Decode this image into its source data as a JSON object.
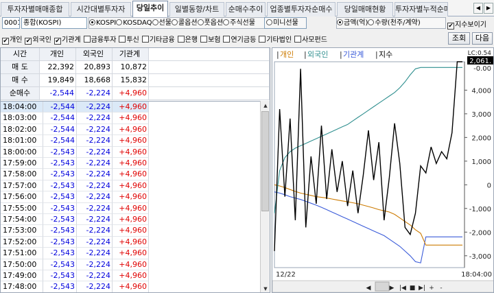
{
  "tabs": [
    "투자자별매매종합",
    "시간대별투자자",
    "당일추이",
    "일별동향/차트",
    "순매수추이",
    "업종별투자자순매수",
    "당일매매현황",
    "투자자별누적순매수"
  ],
  "active_tab": 2,
  "tab_nav": {
    "prev": "◀",
    "next": "▶"
  },
  "market": {
    "code": "0001",
    "name": "종합(KOSPI)"
  },
  "market_options": [
    {
      "label": "KOSPI",
      "selected": true
    },
    {
      "label": "KOSDAQ",
      "selected": false
    },
    {
      "label": "선물",
      "selected": false
    },
    {
      "label": "콜옵션",
      "selected": false
    },
    {
      "label": "풋옵션",
      "selected": false
    },
    {
      "label": "주식선물",
      "selected": false
    }
  ],
  "mini_futures": "미니선물",
  "unit_options": [
    {
      "label": "금액(억)",
      "selected": true
    },
    {
      "label": "수량(천주/계약)",
      "selected": false
    }
  ],
  "index_view": {
    "label": "지수보이기",
    "checked": true
  },
  "investor_filters": [
    {
      "label": "개인",
      "checked": true
    },
    {
      "label": "외국인",
      "checked": true
    },
    {
      "label": "기관계",
      "checked": true
    },
    {
      "label": "금융투자",
      "checked": false
    },
    {
      "label": "투신",
      "checked": false
    },
    {
      "label": "기타금융",
      "checked": false
    },
    {
      "label": "은행",
      "checked": false
    },
    {
      "label": "보험",
      "checked": false
    },
    {
      "label": "연기금등",
      "checked": false
    },
    {
      "label": "기타법인",
      "checked": false
    },
    {
      "label": "사모펀드",
      "checked": false
    }
  ],
  "buttons": {
    "query": "조회",
    "next": "다음"
  },
  "summary": {
    "headers": [
      "시간",
      "개인",
      "외국인",
      "기관계"
    ],
    "rows": [
      {
        "label": "매 도",
        "values": [
          "22,392",
          "20,893",
          "10,872"
        ]
      },
      {
        "label": "매 수",
        "values": [
          "19,849",
          "18,668",
          "15,832"
        ]
      },
      {
        "label": "순매수",
        "values": [
          "-2,544",
          "-2,224",
          "+4,960"
        ]
      }
    ]
  },
  "time_rows": [
    [
      "18:04:00",
      "-2,544",
      "-2,224",
      "+4,960"
    ],
    [
      "18:03:00",
      "-2,544",
      "-2,224",
      "+4,960"
    ],
    [
      "18:02:00",
      "-2,544",
      "-2,224",
      "+4,960"
    ],
    [
      "18:01:00",
      "-2,544",
      "-2,224",
      "+4,960"
    ],
    [
      "18:00:00",
      "-2,543",
      "-2,224",
      "+4,960"
    ],
    [
      "17:59:00",
      "-2,543",
      "-2,224",
      "+4,960"
    ],
    [
      "17:58:00",
      "-2,543",
      "-2,224",
      "+4,960"
    ],
    [
      "17:57:00",
      "-2,543",
      "-2,224",
      "+4,960"
    ],
    [
      "17:56:00",
      "-2,543",
      "-2,224",
      "+4,960"
    ],
    [
      "17:55:00",
      "-2,543",
      "-2,224",
      "+4,960"
    ],
    [
      "17:54:00",
      "-2,543",
      "-2,224",
      "+4,960"
    ],
    [
      "17:53:00",
      "-2,543",
      "-2,224",
      "+4,960"
    ],
    [
      "17:52:00",
      "-2,543",
      "-2,224",
      "+4,960"
    ],
    [
      "17:51:00",
      "-2,543",
      "-2,224",
      "+4,960"
    ],
    [
      "17:50:00",
      "-2,543",
      "-2,224",
      "+4,960"
    ],
    [
      "17:49:00",
      "-2,543",
      "-2,224",
      "+4,960"
    ],
    [
      "17:48:00",
      "-2,543",
      "-2,224",
      "+4,960"
    ]
  ],
  "colors": {
    "negative": "#0000dd",
    "positive": "#e00000",
    "individual": "#cc7a00",
    "foreign": "#2f8f8f",
    "institution": "#3a5bd9",
    "index": "#000000"
  },
  "chart_data": {
    "type": "line",
    "legend": [
      "개인",
      "외국인",
      "기관계",
      "지수"
    ],
    "y_ticks": [
      "4,000",
      "3,000",
      "2,000",
      "1,000",
      "0",
      "-1,000",
      "-2,000",
      "-3,000"
    ],
    "ylim": [
      -3500,
      5200
    ],
    "top_labels": {
      "upper": "LC:0.54",
      "price": "2,061.",
      "sub": "-0.00"
    },
    "x_label": "12/22",
    "x_end_label": "18:04:00",
    "series": [
      {
        "name": "기관계",
        "values": [
          -300,
          -350,
          -420,
          -500,
          -560,
          -620,
          -700,
          -780,
          -860,
          -950,
          -1050,
          -1150,
          -1250,
          -1350,
          -1450,
          -1550,
          -1650,
          -1750,
          -1850,
          -1950,
          -2050,
          -2150,
          -2300,
          -2450,
          -2600,
          -2800,
          -3000,
          -3250,
          -3300,
          -2200,
          -2200,
          -2200,
          -2200,
          -2200,
          -2200,
          -2200,
          -2200
        ]
      },
      {
        "name": "개인",
        "values": [
          0,
          -50,
          -120,
          -200,
          -280,
          -350,
          -400,
          -450,
          -500,
          -530,
          -560,
          -600,
          -640,
          -680,
          -720,
          -760,
          -800,
          -860,
          -920,
          -980,
          -1050,
          -1100,
          -1150,
          -1250,
          -1400,
          -1550,
          -1700,
          -1900,
          -2050,
          -2550,
          -2550,
          -2550,
          -2550,
          -2550,
          -2550,
          -2550,
          -2550
        ]
      },
      {
        "name": "외국인",
        "values": [
          -1200,
          600,
          1150,
          1400,
          1550,
          1650,
          1750,
          1850,
          1950,
          2050,
          2150,
          2250,
          2350,
          2450,
          2550,
          2700,
          2850,
          3000,
          3150,
          3300,
          3450,
          3600,
          3750,
          3900,
          4100,
          4350,
          4650,
          4900,
          4960,
          4960,
          4960,
          4960,
          4960,
          4960,
          4960,
          4960,
          4960
        ]
      },
      {
        "name": "지수",
        "values": [
          -2800,
          3200,
          -500,
          2800,
          -1500,
          4900,
          -1800,
          1200,
          -800,
          2500,
          -600,
          1500,
          -300,
          1000,
          -900,
          600,
          -1200,
          400,
          2300,
          200,
          1800,
          -1500,
          300,
          2600,
          900,
          -1800,
          -2100,
          -1200,
          800,
          500,
          1600,
          900,
          1400,
          1100,
          2200,
          5200,
          5200
        ]
      }
    ]
  },
  "chart_nav": [
    "◀",
    "▶",
    "|◀",
    "■",
    "▶|",
    "+",
    "-"
  ]
}
